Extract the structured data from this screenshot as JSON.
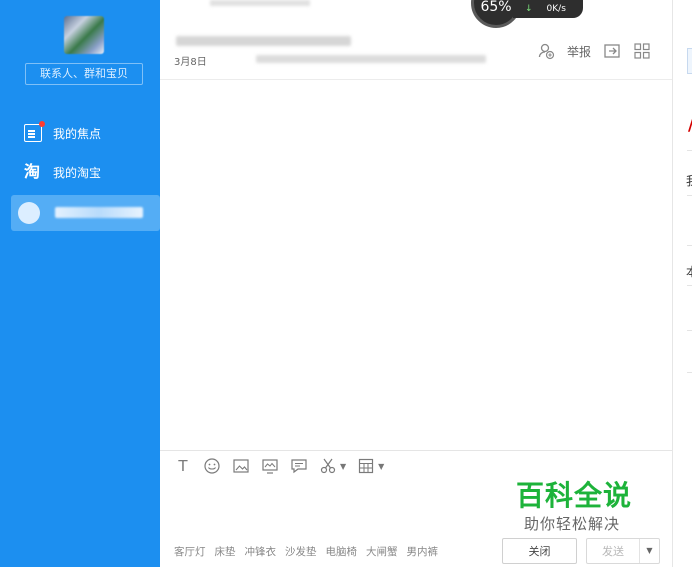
{
  "sidebar": {
    "search_placeholder": "联系人、群和宝贝",
    "items": [
      {
        "label": "我的焦点",
        "icon": "news-focus-icon"
      },
      {
        "label": "我的淘宝",
        "icon": "taobao-icon"
      }
    ]
  },
  "header": {
    "date_prefix": "3月8日",
    "report_label": "举报",
    "gauge_value": "65%",
    "net_speed": "0K/s"
  },
  "toolbar": {
    "icons": [
      "text-format-icon",
      "emoji-icon",
      "image-icon",
      "screenshot-icon",
      "message-icon",
      "scissors-icon",
      "calculator-icon"
    ]
  },
  "tags": [
    "客厅灯",
    "床垫",
    "冲锋衣",
    "沙发垫",
    "电脑椅",
    "大闸蟹",
    "男内裤"
  ],
  "buttons": {
    "close_label": "关闭",
    "send_label": "发送"
  },
  "right_panel": {
    "chars": [
      "我",
      "本"
    ]
  },
  "watermark": {
    "title": "百科全说",
    "subtitle": "助你轻松解决"
  },
  "colors": {
    "sidebar_bg": "#1c8ff0",
    "sidebar_active": "#54adf5",
    "watermark_green": "#1db33a"
  }
}
